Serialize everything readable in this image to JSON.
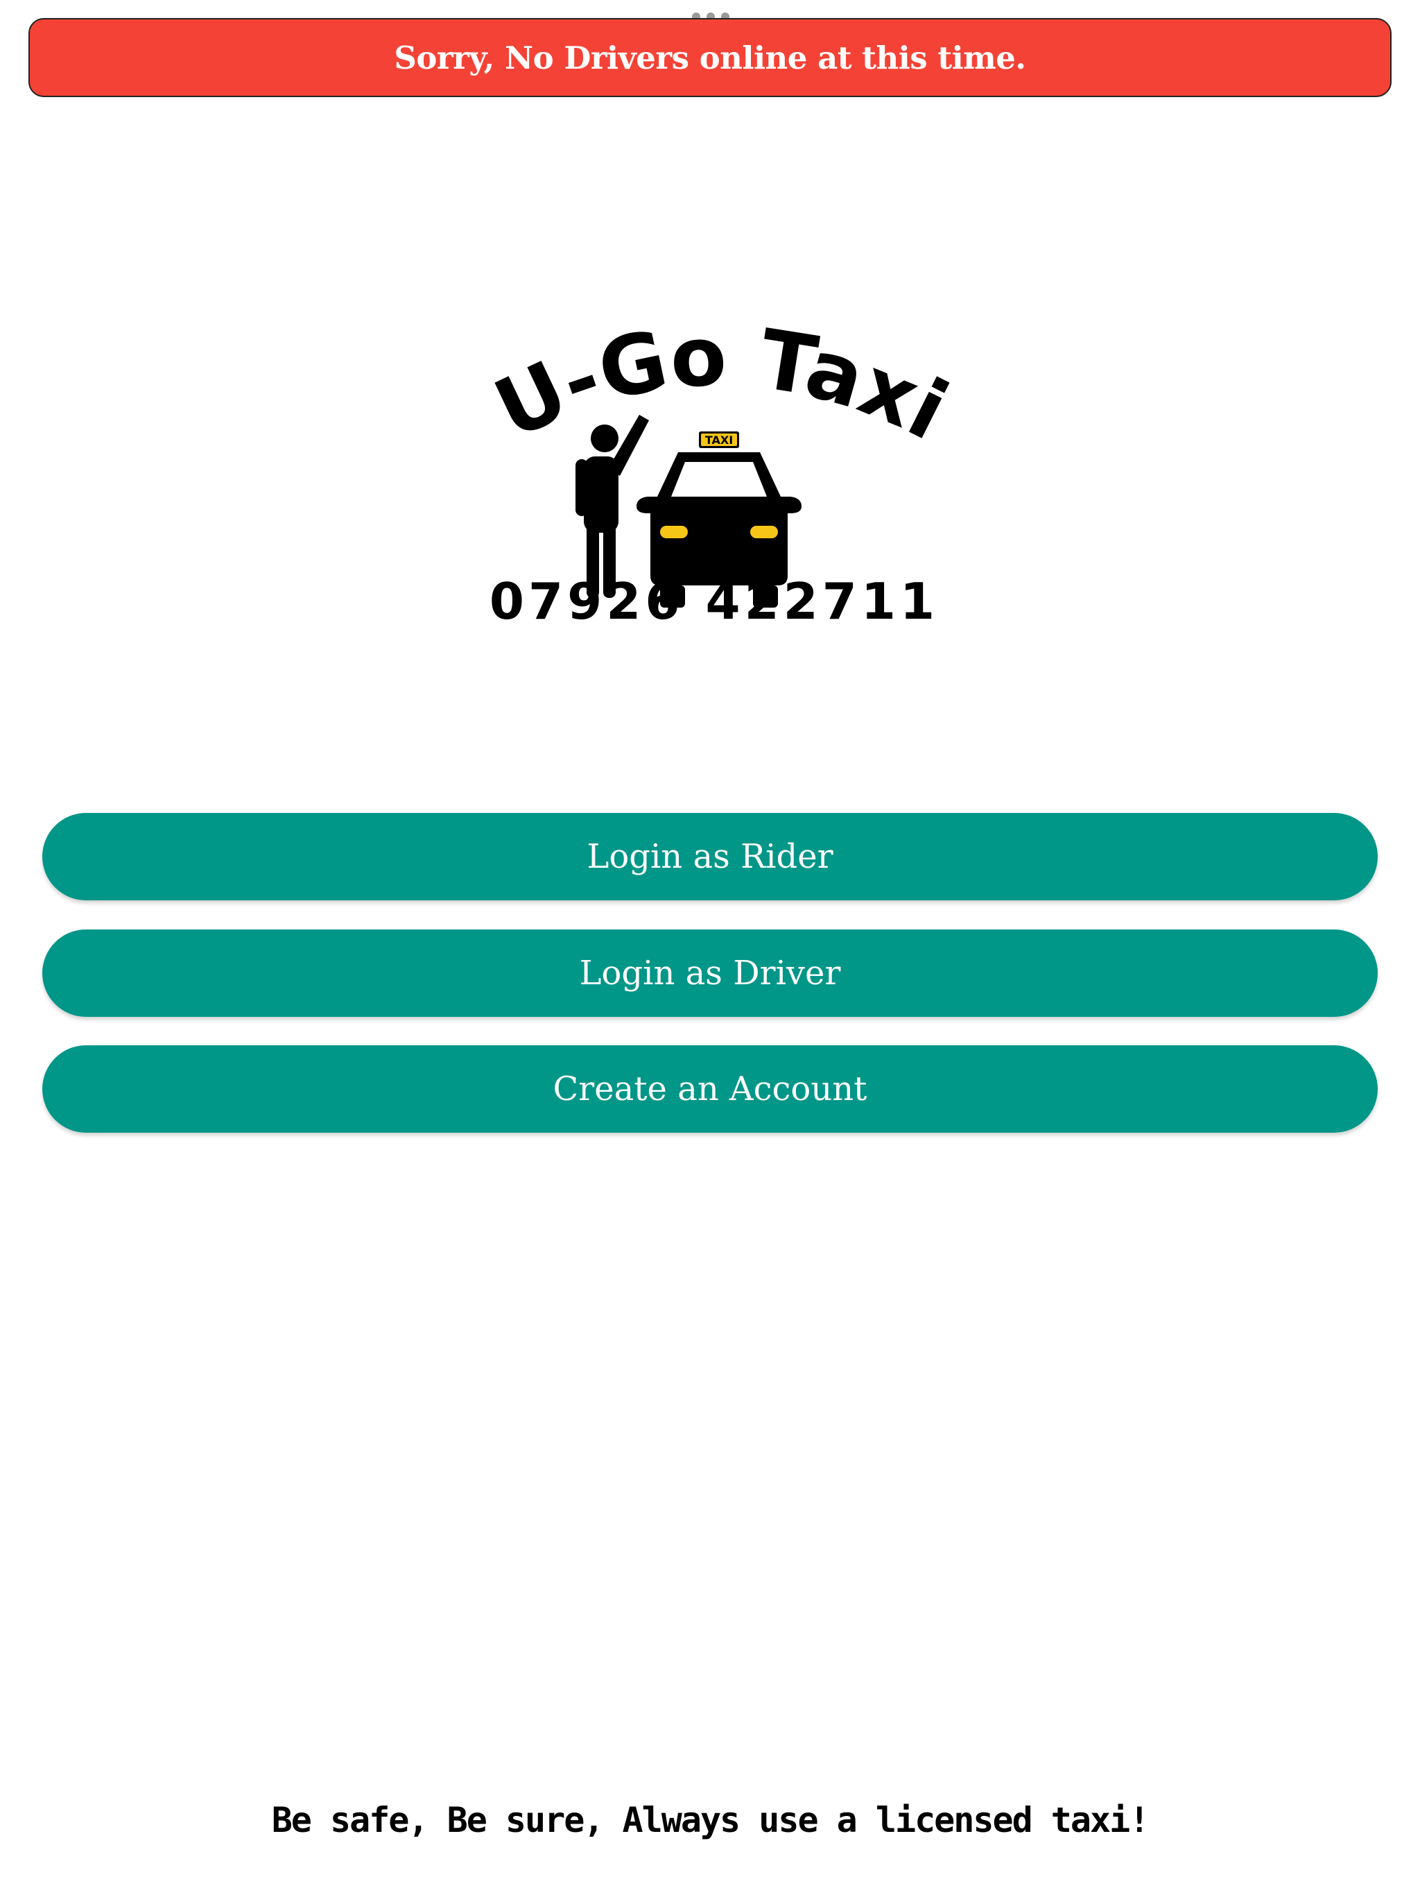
{
  "alert": {
    "message": "Sorry, No Drivers online at this time.",
    "background_color": "#f44336"
  },
  "logo": {
    "title": "U-Go Taxi",
    "phone": "07926 422711",
    "taxi_sign": "TAXI",
    "icons": [
      "person-hailing-icon",
      "taxi-car-icon"
    ]
  },
  "buttons": {
    "login_rider": "Login as Rider",
    "login_driver": "Login as Driver",
    "create_account": "Create an Account",
    "color": "#009688"
  },
  "footer": {
    "slogan": "Be safe, Be sure, Always use a licensed taxi!"
  }
}
